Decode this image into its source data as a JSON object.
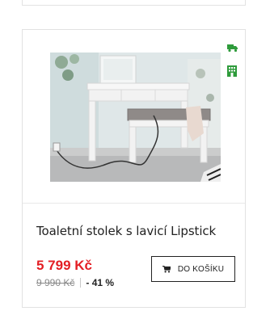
{
  "product": {
    "title": "Toaletní stolek s lavicí Lipstick",
    "price": "5 799 Kč",
    "old_price": "9 990 Kč",
    "discount": "- 41 %",
    "cart_label": "DO KOŠÍKU"
  },
  "icons": {
    "delivery": "truck-icon",
    "availability": "store-icon",
    "cart": "cart-icon"
  },
  "colors": {
    "price": "#e31e24",
    "icon_green": "#2e9b3b"
  }
}
